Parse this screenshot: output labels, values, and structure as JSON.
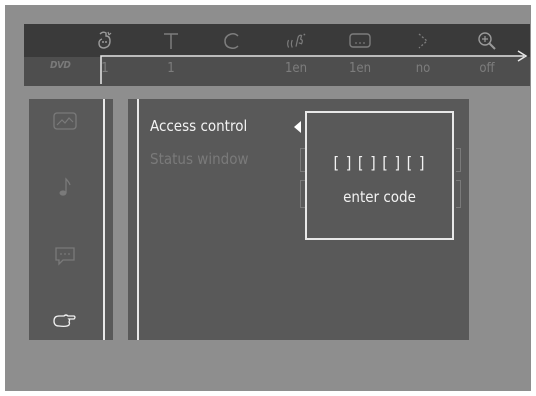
{
  "top_bar": {
    "logo": "DVD",
    "items": [
      {
        "icon": "angle-icon",
        "value": ""
      },
      {
        "icon": "title-icon",
        "value": "1"
      },
      {
        "icon": "chapter-icon",
        "value": "1"
      },
      {
        "icon": "audio-icon",
        "value": "1en"
      },
      {
        "icon": "subtitle-icon",
        "value": "1en"
      },
      {
        "icon": "slowmotion-icon",
        "value": "no"
      },
      {
        "icon": "zoom-icon",
        "value": "off"
      }
    ]
  },
  "sidebar": {
    "items": [
      {
        "icon": "picture-settings-icon"
      },
      {
        "icon": "sound-settings-icon"
      },
      {
        "icon": "language-settings-icon"
      },
      {
        "icon": "features-icon"
      }
    ]
  },
  "menu": {
    "items": [
      {
        "label": "Access control",
        "state": "selected"
      },
      {
        "label": "Status window",
        "state": "dimmed"
      }
    ]
  },
  "code_dialog": {
    "slots": "[ ] [ ] [ ] [ ]",
    "prompt": "enter code"
  },
  "colors": {
    "background": "#8e8e8e",
    "panel": "#595959",
    "highlight_text": "#f2f2f2",
    "dim_text": "#7a7a7a"
  }
}
